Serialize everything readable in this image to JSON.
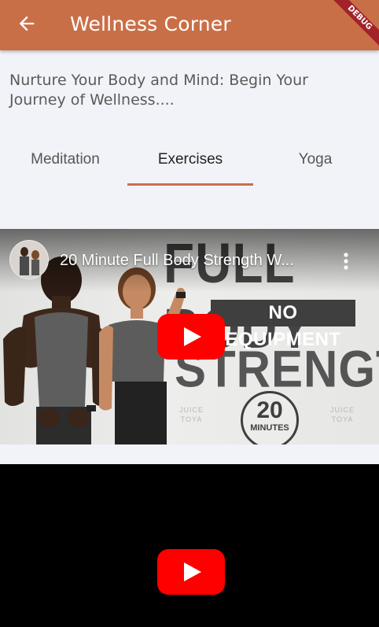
{
  "app_bar": {
    "title": "Wellness Corner",
    "background_color": "#c96f47",
    "back_icon": "arrow-back-icon",
    "debug_label": "DEBUG"
  },
  "intro": {
    "text": "Nurture Your Body and Mind: Begin Your Journey of Wellness...."
  },
  "tabs": {
    "items": [
      {
        "label": "Meditation",
        "active": false
      },
      {
        "label": "Exercises",
        "active": true
      },
      {
        "label": "Yoga",
        "active": false
      }
    ],
    "indicator_color": "#c96f47"
  },
  "videos": [
    {
      "title": "20 Minute Full Body Strength W...",
      "thumbnail": {
        "headline": "FULL BODY",
        "badge": "NO EQUIPMENT",
        "subheadline": "STRENGTH",
        "minutes_number": "20",
        "minutes_unit": "MINUTES",
        "watermark_left": "JUICE\nTOYA",
        "watermark_right": "JUICE\nTOYA"
      },
      "play_icon": "youtube-play-icon",
      "menu_icon": "more-vert-icon"
    },
    {
      "title": "",
      "play_icon": "youtube-play-icon"
    }
  ],
  "colors": {
    "page_background": "#f1f3f8",
    "youtube_red": "#ff0000"
  }
}
